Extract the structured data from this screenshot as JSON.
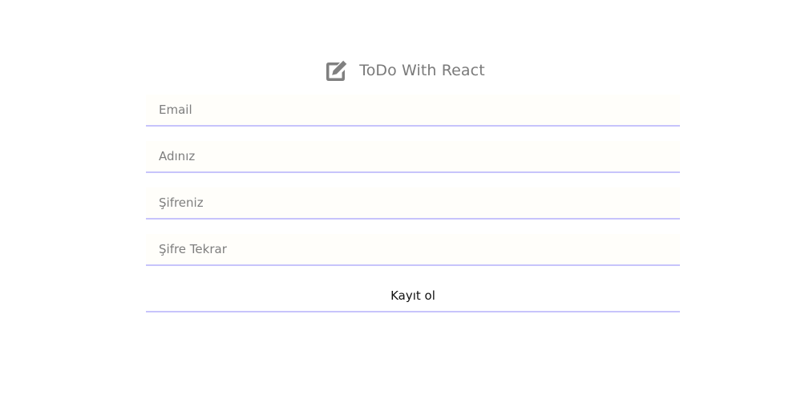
{
  "header": {
    "title": "ToDo With React",
    "icon": "edit-icon"
  },
  "form": {
    "fields": [
      {
        "placeholder": "Email"
      },
      {
        "placeholder": "Adınız"
      },
      {
        "placeholder": "Şifreniz"
      },
      {
        "placeholder": "Şifre Tekrar"
      }
    ],
    "submit_label": "Kayıt ol"
  },
  "colors": {
    "underline": "#c7c4fb",
    "title": "#7a7a7a",
    "icon": "#808080"
  }
}
